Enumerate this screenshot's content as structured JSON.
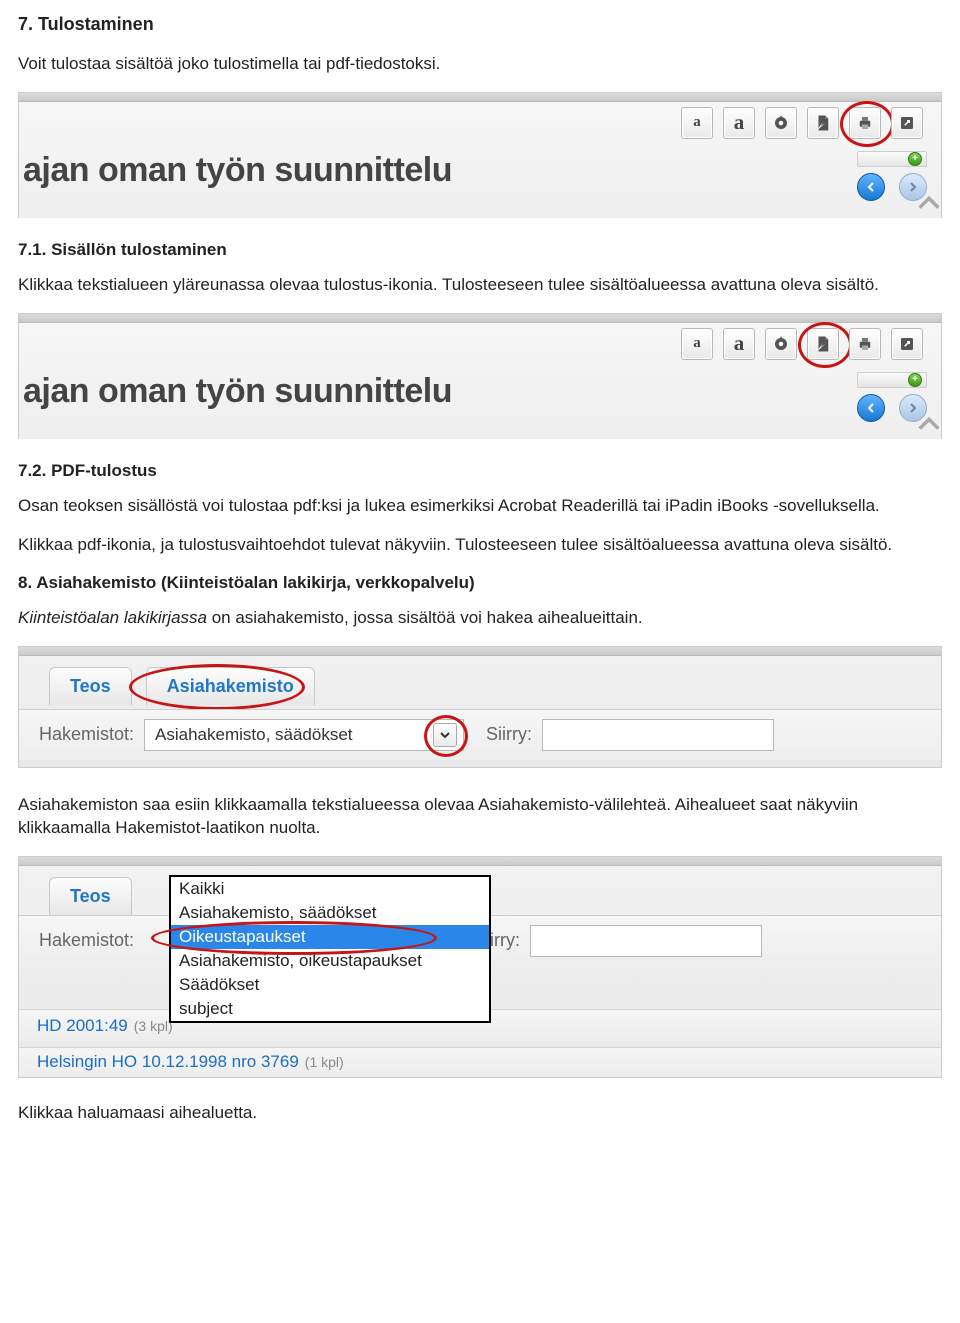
{
  "sec7": {
    "title": "7.  Tulostaminen",
    "intro": "Voit tulostaa sisältöä joko tulostimella tai pdf-tiedostoksi.",
    "shot_heading": "ajan oman työn suunnittelu",
    "toolbar": {
      "a_small": "a",
      "a_big": "a"
    }
  },
  "sec71": {
    "title": "7.1.  Sisällön tulostaminen",
    "p": "Klikkaa tekstialueen yläreunassa olevaa tulostus-ikonia. Tulosteeseen tulee sisältöalueessa avattuna oleva sisältö."
  },
  "sec72": {
    "title": "7.2.    PDF-tulostus",
    "p1": "Osan teoksen sisällöstä voi tulostaa pdf:ksi ja lukea esimerkiksi Acrobat Readerillä tai iPadin iBooks -sovelluksella.",
    "p2": "Klikkaa pdf-ikonia, ja tulostusvaihtoehdot tulevat näkyviin. Tulosteeseen tulee sisältöalueessa avattuna oleva sisältö."
  },
  "sec8": {
    "title": "8.  Asiahakemisto (Kiinteistöalan lakikirja, verkkopalvelu)",
    "p_em": "Kiinteistöalan lakikirjassa",
    "p_rest": " on asiahakemisto, jossa sisältöä voi hakea aihealueittain.",
    "tabs": {
      "teos": "Teos",
      "asia": "Asiahakemisto"
    },
    "form": {
      "hak_label": "Hakemistot:",
      "hak_value": "Asiahakemisto, säädökset",
      "siirry": "Siirry:"
    },
    "p2": "Asiahakemiston saa esiin klikkaamalla tekstialueessa olevaa Asiahakemisto-välilehteä. Aihealueet saat näkyviin klikkaamalla Hakemistot-laatikon nuolta.",
    "dropdown": {
      "opts": [
        "Kaikki",
        "Asiahakemisto, säädökset",
        "Oikeustapaukset",
        "Asiahakemisto, oikeustapaukset",
        "Säädökset",
        "subject"
      ]
    },
    "results": {
      "r1": "HD 2001:49",
      "r1c": "(3 kpl)",
      "r2": "Helsingin HO 10.12.1998 nro 3769",
      "r2c": "(1 kpl)"
    },
    "p3": "Klikkaa haluamaasi aihealuetta."
  }
}
